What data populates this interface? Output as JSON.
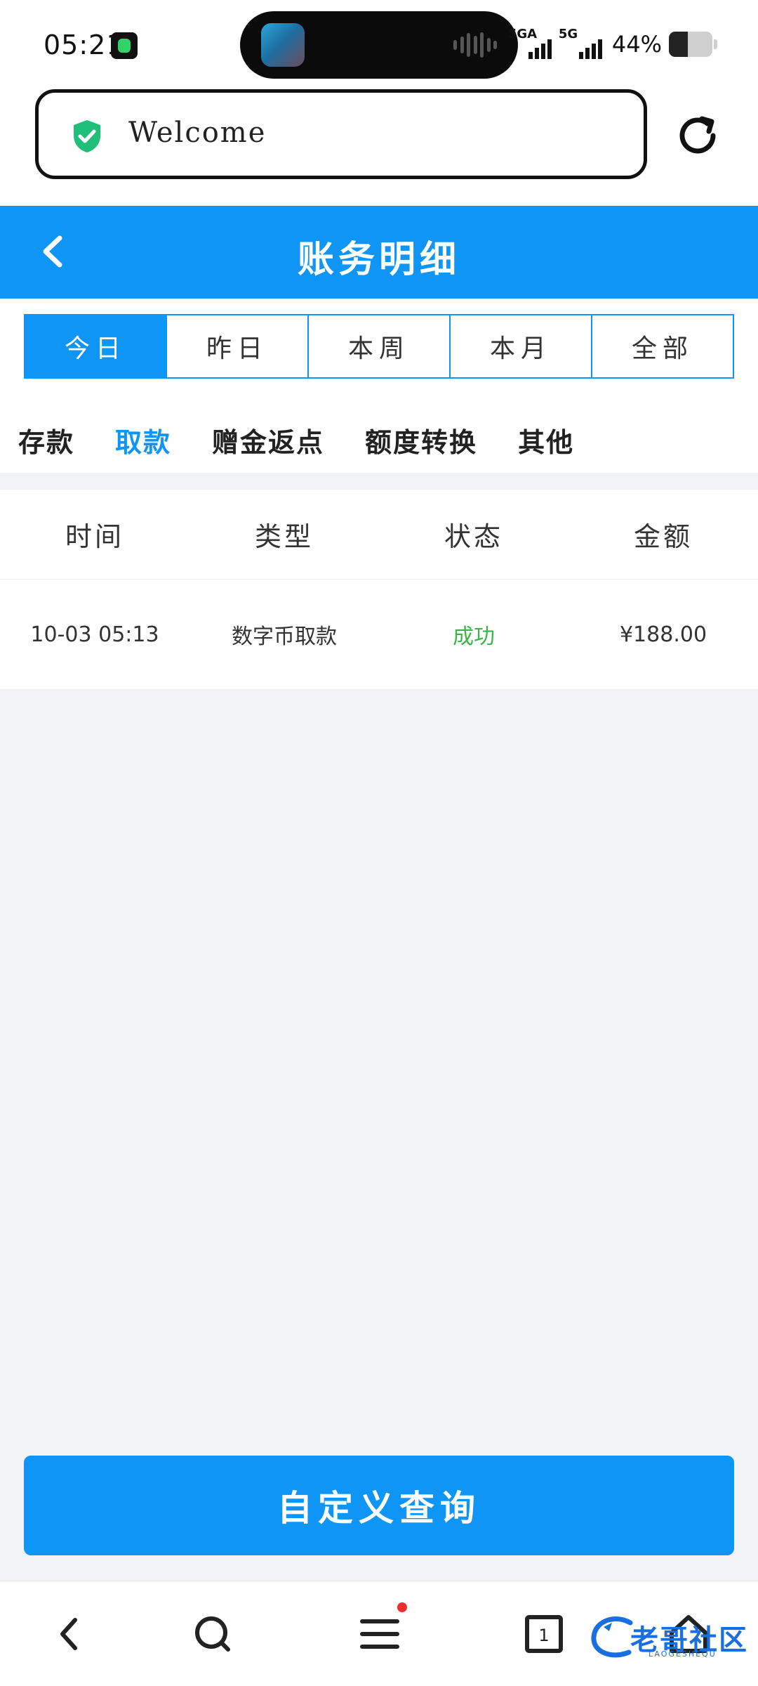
{
  "status_bar": {
    "time": "05:21",
    "net1": "5GA",
    "net2": "5G",
    "battery_pct": "44%",
    "battery_level": 0.44
  },
  "browser": {
    "url_text": "Welcome",
    "icons": [
      "shield-check-icon",
      "reload-icon"
    ]
  },
  "header": {
    "title": "账务明细",
    "back_icon": "chevron-left-icon"
  },
  "period_tabs": [
    {
      "label": "今日",
      "active": true
    },
    {
      "label": "昨日",
      "active": false
    },
    {
      "label": "本周",
      "active": false
    },
    {
      "label": "本月",
      "active": false
    },
    {
      "label": "全部",
      "active": false
    }
  ],
  "category_tabs": [
    {
      "label": "存款",
      "active": false
    },
    {
      "label": "取款",
      "active": true
    },
    {
      "label": "赠金返点",
      "active": false
    },
    {
      "label": "额度转换",
      "active": false
    },
    {
      "label": "其他",
      "active": false
    }
  ],
  "table": {
    "columns": [
      "时间",
      "类型",
      "状态",
      "金额"
    ],
    "rows": [
      {
        "time": "10-03 05:13",
        "type": "数字币取款",
        "status": "成功",
        "amount": "¥188.00"
      }
    ]
  },
  "query_button": "自定义查询",
  "bottom_nav": [
    "back-icon",
    "search-icon",
    "menu-icon",
    "tabs-icon",
    "home-icon"
  ],
  "tabs_count": "1",
  "watermark": {
    "text": "老哥社区",
    "sub": "LAOGESHEQU"
  },
  "colors": {
    "primary": "#0f95f5",
    "success": "#3ab54a",
    "background": "#f2f3f5"
  }
}
